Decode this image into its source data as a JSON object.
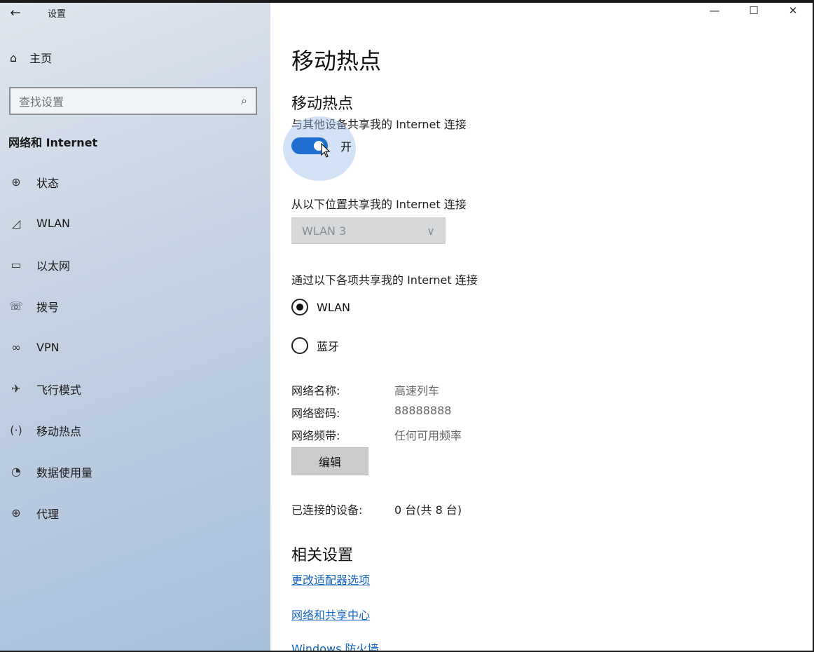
{
  "window": {
    "title": "设置",
    "back_icon": "←",
    "controls": {
      "minimize": "—",
      "maximize": "☐",
      "close": "✕"
    }
  },
  "sidebar": {
    "home_icon": "⌂",
    "home_label": "主页",
    "search_placeholder": "查找设置",
    "search_icon": "⌕",
    "section": "网络和 Internet",
    "items": [
      {
        "icon": "⊕",
        "label": "状态"
      },
      {
        "icon": "◿",
        "label": "WLAN"
      },
      {
        "icon": "▭",
        "label": "以太网"
      },
      {
        "icon": "☏",
        "label": "拨号"
      },
      {
        "icon": "∞",
        "label": "VPN"
      },
      {
        "icon": "✈",
        "label": "飞行模式"
      },
      {
        "icon": "(·)",
        "label": "移动热点"
      },
      {
        "icon": "◔",
        "label": "数据使用量"
      },
      {
        "icon": "⊕",
        "label": "代理"
      }
    ]
  },
  "main": {
    "page_title": "移动热点",
    "subhead": "移动热点",
    "share_desc": "与其他设备共享我的 Internet 连接",
    "toggle": {
      "state": "开",
      "on": true
    },
    "source_label": "从以下位置共享我的 Internet 连接",
    "source_value": "WLAN 3",
    "source_chevron": "∨",
    "via_label": "通过以下各项共享我的 Internet 连接",
    "radio_options": [
      {
        "label": "WLAN",
        "selected": true
      },
      {
        "label": "蓝牙",
        "selected": false
      }
    ],
    "network_name_label": "网络名称:",
    "network_name": "高速列车",
    "network_password_label": "网络密码:",
    "network_password": "88888888",
    "network_band_label": "网络频带:",
    "network_band": "任何可用频率",
    "edit_button": "编辑",
    "connected_label": "已连接的设备:",
    "connected_value": "0 台(共 8 台)",
    "related_heading": "相关设置",
    "links": [
      "更改适配器选项",
      "网络和共享中心",
      "Windows 防火墙"
    ]
  },
  "colors": {
    "accent": "#1f6fd0",
    "link": "#1565c0",
    "sidebar_bg": "#c7d3e2"
  }
}
